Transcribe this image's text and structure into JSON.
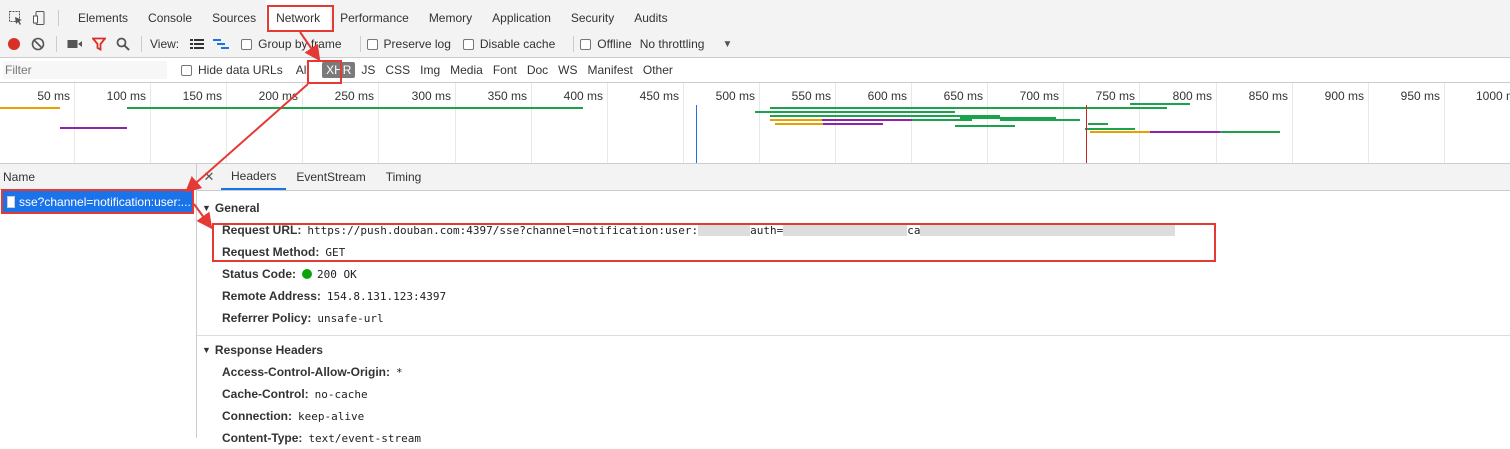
{
  "tabs": [
    "Elements",
    "Console",
    "Sources",
    "Network",
    "Performance",
    "Memory",
    "Application",
    "Security",
    "Audits"
  ],
  "toolbar": {
    "view_label": "View:",
    "group_by_frame": "Group by frame",
    "preserve_log": "Preserve log",
    "disable_cache": "Disable cache",
    "offline": "Offline",
    "throttling": "No throttling"
  },
  "filterbar": {
    "filter_placeholder": "Filter",
    "hide_data_urls": "Hide data URLs",
    "types": [
      "All",
      "XHR",
      "JS",
      "CSS",
      "Img",
      "Media",
      "Font",
      "Doc",
      "WS",
      "Manifest",
      "Other"
    ],
    "active_type": "XHR"
  },
  "timeline": {
    "labels": [
      "50 ms",
      "100 ms",
      "150 ms",
      "200 ms",
      "250 ms",
      "300 ms",
      "350 ms",
      "400 ms",
      "450 ms",
      "500 ms",
      "550 ms",
      "600 ms",
      "650 ms",
      "700 ms",
      "750 ms",
      "800 ms",
      "850 ms",
      "900 ms",
      "950 ms",
      "1000 m"
    ]
  },
  "requests": {
    "column_header": "Name",
    "items": [
      {
        "name": "sse?channel=notification:user:..."
      }
    ]
  },
  "detail": {
    "tabs": [
      "Headers",
      "EventStream",
      "Timing"
    ],
    "general": {
      "title": "General",
      "request_url_key": "Request URL:",
      "request_url_value": "https://push.douban.com:4397/sse?channel=notification:user:",
      "request_url_fragment_auth": "auth=",
      "request_url_fragment_tail": "ca",
      "request_method_key": "Request Method:",
      "request_method_value": "GET",
      "status_code_key": "Status Code:",
      "status_code_value": "200 OK",
      "remote_address_key": "Remote Address:",
      "remote_address_value": "154.8.131.123:4397",
      "referrer_policy_key": "Referrer Policy:",
      "referrer_policy_value": "unsafe-url"
    },
    "response_headers": {
      "title": "Response Headers",
      "rows": [
        {
          "key": "Access-Control-Allow-Origin:",
          "value": "*"
        },
        {
          "key": "Cache-Control:",
          "value": "no-cache"
        },
        {
          "key": "Connection:",
          "value": "keep-alive"
        },
        {
          "key": "Content-Type:",
          "value": "text/event-stream"
        }
      ]
    }
  },
  "colors": {
    "accent": "#1a73e8",
    "annotation": "#e53935",
    "record": "#d93025"
  }
}
